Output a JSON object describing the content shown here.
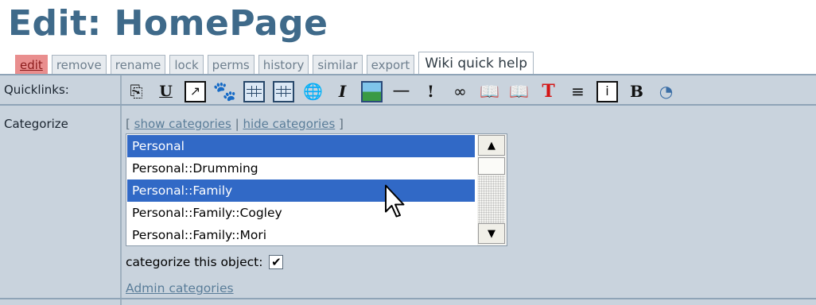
{
  "page": {
    "title": "Edit: HomePage"
  },
  "tabs": [
    {
      "label": "edit",
      "active": true
    },
    {
      "label": "remove"
    },
    {
      "label": "rename"
    },
    {
      "label": "lock"
    },
    {
      "label": "perms"
    },
    {
      "label": "history"
    },
    {
      "label": "similar"
    },
    {
      "label": "export"
    }
  ],
  "help_tab": {
    "label": "Wiki quick help"
  },
  "quicklinks": {
    "label": "Quicklinks:",
    "icons": [
      {
        "name": "copy-icon",
        "glyph": "⎘"
      },
      {
        "name": "underline-icon",
        "glyph": "U"
      },
      {
        "name": "external-link-icon",
        "glyph": "↗"
      },
      {
        "name": "paw-icon",
        "glyph": "🐾"
      },
      {
        "name": "table-icon",
        "glyph": ""
      },
      {
        "name": "table-alt-icon",
        "glyph": ""
      },
      {
        "name": "globe-link-icon",
        "glyph": "🌐"
      },
      {
        "name": "italic-icon",
        "glyph": "I"
      },
      {
        "name": "image-icon",
        "glyph": ""
      },
      {
        "name": "horizontal-rule-icon",
        "glyph": "—"
      },
      {
        "name": "exclamation-icon",
        "glyph": "!"
      },
      {
        "name": "link-icon",
        "glyph": "∞"
      },
      {
        "name": "book-icon",
        "glyph": "📖"
      },
      {
        "name": "book-alt-icon",
        "glyph": "📖"
      },
      {
        "name": "title-text-icon",
        "glyph": "T"
      },
      {
        "name": "align-center-icon",
        "glyph": "≡"
      },
      {
        "name": "info-icon",
        "glyph": "i"
      },
      {
        "name": "bold-icon",
        "glyph": "B"
      },
      {
        "name": "partial-icon",
        "glyph": "◔"
      }
    ]
  },
  "categorize": {
    "label": "Categorize",
    "links_open": "[",
    "show_label": "show categories",
    "separator": "|",
    "hide_label": "hide categories",
    "links_close": "]",
    "items": [
      {
        "label": "Personal",
        "selected": true
      },
      {
        "label": "Personal::Drumming",
        "selected": false
      },
      {
        "label": "Personal::Family",
        "selected": true
      },
      {
        "label": "Personal::Family::Cogley",
        "selected": false
      },
      {
        "label": "Personal::Family::Mori",
        "selected": false
      }
    ],
    "checkbox_label": "categorize this object:",
    "checkbox_checked": true,
    "checkbox_mark": "✔",
    "admin_link": "Admin categories"
  },
  "scrollbar": {
    "up_glyph": "▲",
    "down_glyph": "▼"
  }
}
